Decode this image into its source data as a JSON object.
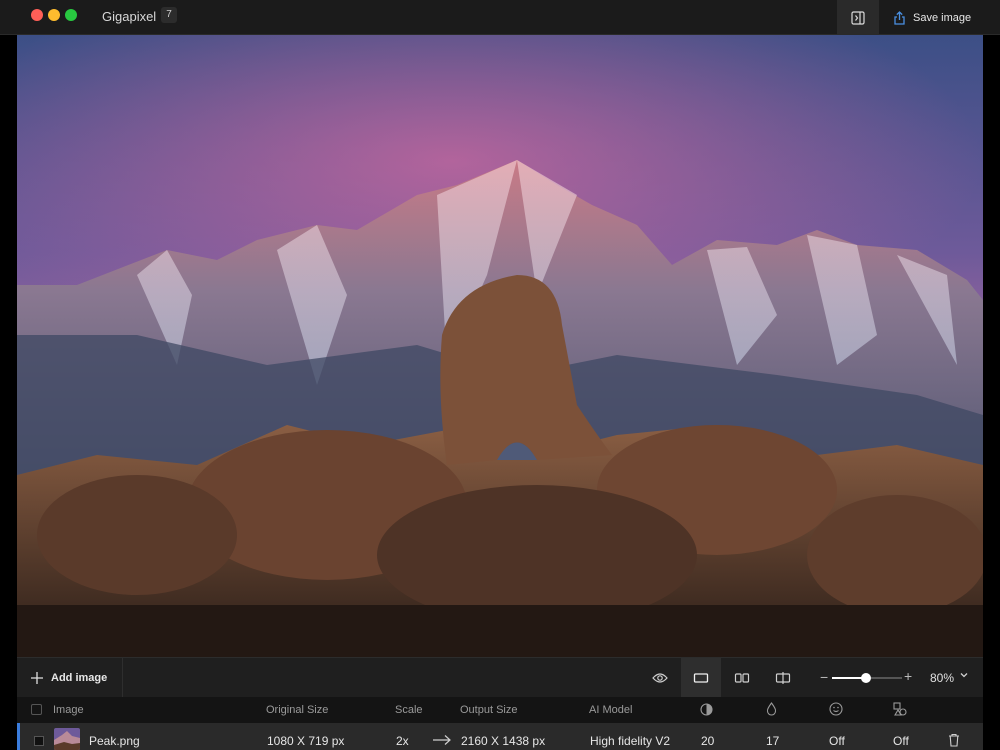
{
  "window": {
    "title": "Gigapixel",
    "badge_count": "7",
    "save_label": "Save image"
  },
  "toolbar": {
    "add_label": "Add image",
    "zoom_value": "80%",
    "zoom_level_fraction": 0.48
  },
  "table": {
    "headers": [
      "Image",
      "Original Size",
      "Scale",
      "Output Size",
      "AI Model"
    ],
    "header_icons": [
      "half-circle-icon",
      "droplet-icon",
      "smiley-icon",
      "shapes-icon"
    ],
    "rows": [
      {
        "name": "Peak.png",
        "original_size": "1080 X 719 px",
        "scale": "2x",
        "output_size": "2160 X 1438 px",
        "ai_model": "High fidelity V2",
        "value_1": "20",
        "value_2": "17",
        "value_3": "Off",
        "value_4": "Off"
      }
    ]
  },
  "colors": {
    "accent": "#3b7ddd",
    "titlebar": "#1b1b1b",
    "toolbar": "#1f1f1f",
    "row": "#2a2a2a"
  }
}
